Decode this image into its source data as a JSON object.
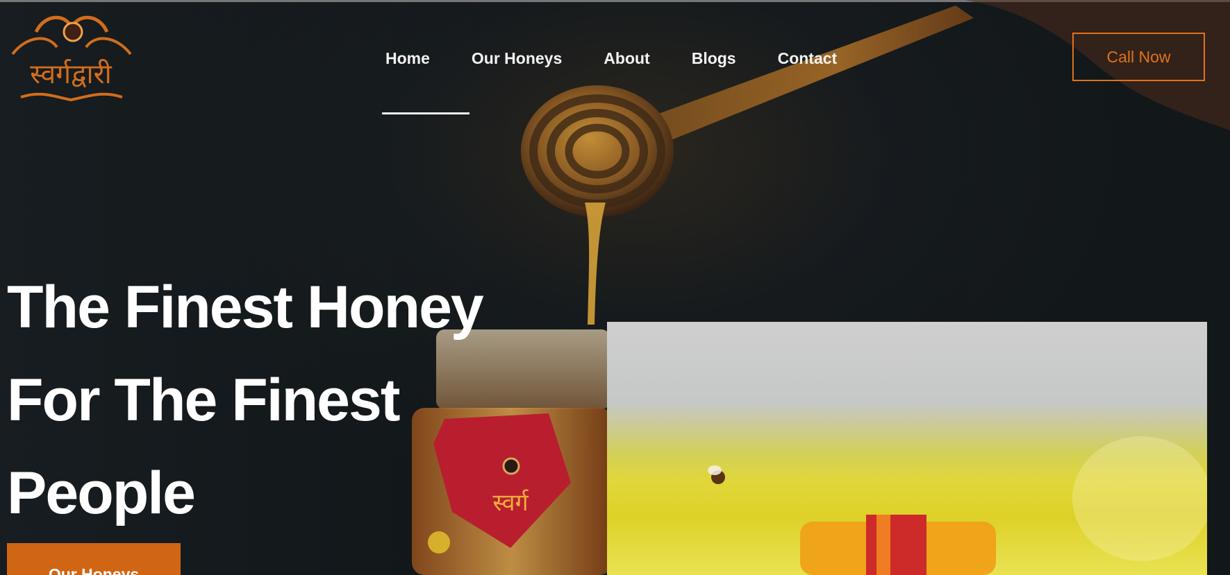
{
  "brand": {
    "name": "स्वर्गद्वारी",
    "logo_icon": "bee-crest-logo"
  },
  "nav": {
    "items": [
      {
        "label": "Home"
      },
      {
        "label": "Our Honeys"
      },
      {
        "label": "About"
      },
      {
        "label": "Blogs"
      },
      {
        "label": "Contact"
      }
    ]
  },
  "header": {
    "call_label": "Call Now"
  },
  "hero": {
    "line1": "The Finest Honey",
    "line2": "For The Finest",
    "line3": "People",
    "cta_label": "Our Honeys"
  },
  "colors": {
    "accent": "#e2721a",
    "cta": "#d06514",
    "background": "#111518",
    "text": "#ffffff"
  }
}
